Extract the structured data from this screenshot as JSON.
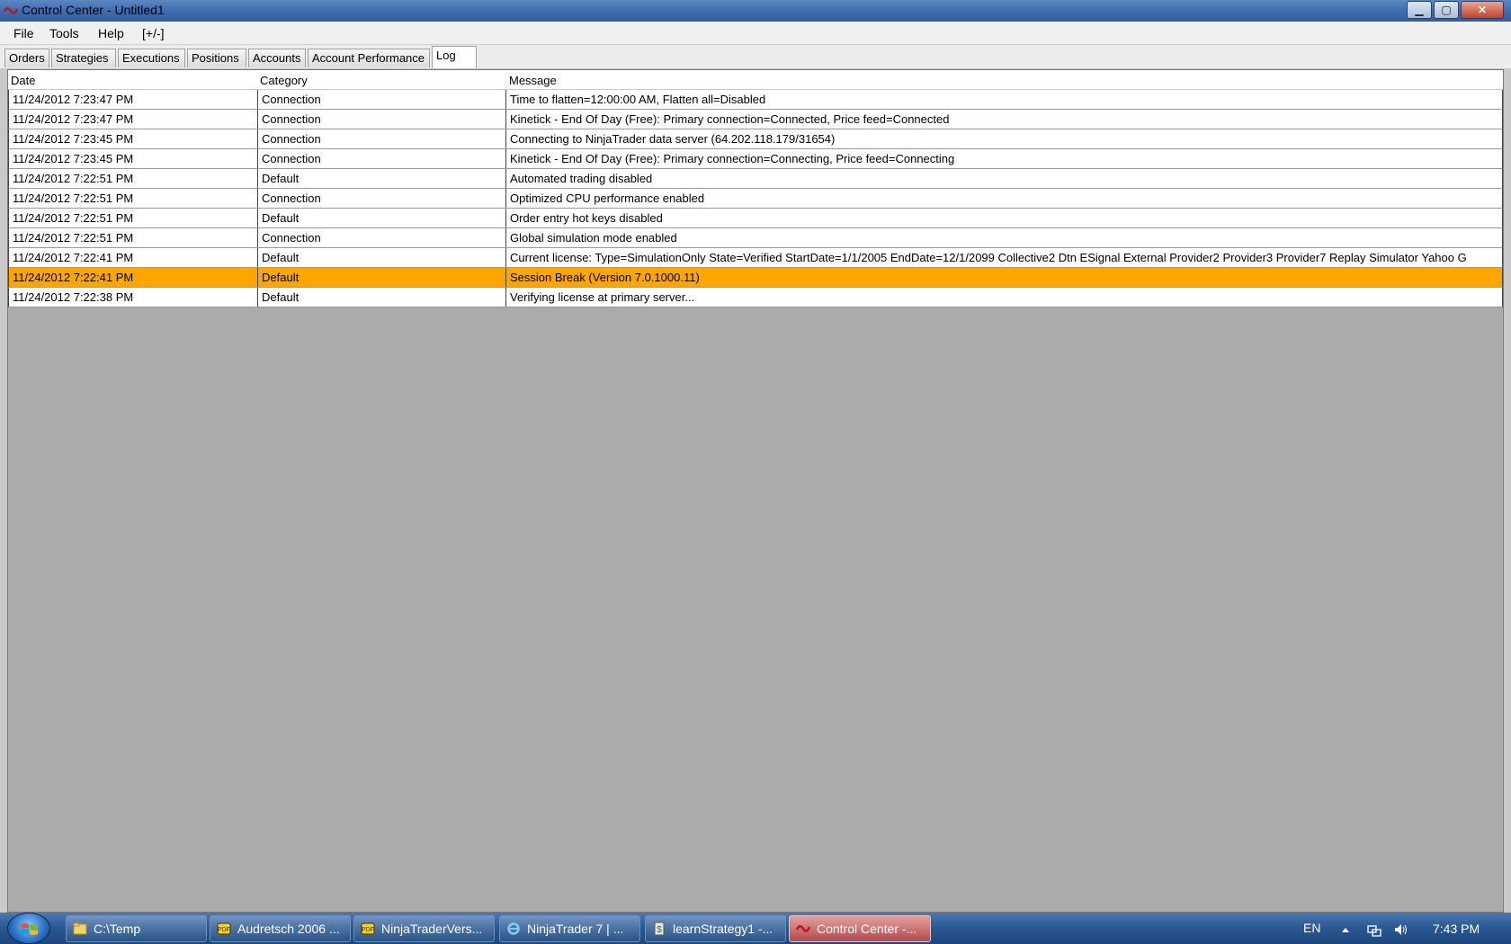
{
  "window": {
    "title": "Control Center - Untitled1",
    "min_glyph": "▁",
    "max_glyph": "▢",
    "close_glyph": "✕"
  },
  "menu": [
    "File",
    "Tools",
    "Help",
    "[+/-]"
  ],
  "tabs": [
    {
      "label": "Orders",
      "active": false
    },
    {
      "label": "Strategies",
      "active": false
    },
    {
      "label": "Executions",
      "active": false
    },
    {
      "label": "Positions",
      "active": false
    },
    {
      "label": "Accounts",
      "active": false
    },
    {
      "label": "Account Performance",
      "active": false
    },
    {
      "label": "Log",
      "active": true
    }
  ],
  "log": {
    "columns": [
      "Date",
      "Category",
      "Message"
    ],
    "rows": [
      {
        "date": "11/24/2012 7:23:47 PM",
        "category": "Connection",
        "message": "Time to flatten=12:00:00 AM, Flatten all=Disabled",
        "highlight": false
      },
      {
        "date": "11/24/2012 7:23:47 PM",
        "category": "Connection",
        "message": "Kinetick - End Of Day (Free): Primary connection=Connected, Price feed=Connected",
        "highlight": false
      },
      {
        "date": "11/24/2012 7:23:45 PM",
        "category": "Connection",
        "message": "Connecting to NinjaTrader data server (64.202.118.179/31654)",
        "highlight": false
      },
      {
        "date": "11/24/2012 7:23:45 PM",
        "category": "Connection",
        "message": "Kinetick - End Of Day (Free): Primary connection=Connecting, Price feed=Connecting",
        "highlight": false
      },
      {
        "date": "11/24/2012 7:22:51 PM",
        "category": "Default",
        "message": "Automated trading disabled",
        "highlight": false
      },
      {
        "date": "11/24/2012 7:22:51 PM",
        "category": "Connection",
        "message": "Optimized CPU performance enabled",
        "highlight": false
      },
      {
        "date": "11/24/2012 7:22:51 PM",
        "category": "Default",
        "message": "Order entry hot keys disabled",
        "highlight": false
      },
      {
        "date": "11/24/2012 7:22:51 PM",
        "category": "Connection",
        "message": "Global simulation mode enabled",
        "highlight": false
      },
      {
        "date": "11/24/2012 7:22:41 PM",
        "category": "Default",
        "message": "Current license: Type=SimulationOnly State=Verified StartDate=1/1/2005 EndDate=12/1/2099 Collective2 Dtn ESignal External Provider2 Provider3 Provider7 Replay Simulator Yahoo G",
        "highlight": false
      },
      {
        "date": "11/24/2012 7:22:41 PM",
        "category": "Default",
        "message": "Session Break (Version 7.0.1000.11)",
        "highlight": true
      },
      {
        "date": "11/24/2012 7:22:38 PM",
        "category": "Default",
        "message": "Verifying license at primary server...",
        "highlight": false
      }
    ],
    "highlight_color": "#ffa500"
  },
  "taskbar": {
    "items": [
      {
        "label": "C:\\Temp",
        "icon": "folder-icon",
        "active": false
      },
      {
        "label": "Audretsch 2006 ...",
        "icon": "pdf-icon",
        "active": false
      },
      {
        "label": "NinjaTraderVers...",
        "icon": "pdf-icon",
        "active": false
      },
      {
        "label": "NinjaTrader 7 | ...",
        "icon": "ie-icon",
        "active": false
      },
      {
        "label": "learnStrategy1 -...",
        "icon": "script-icon",
        "active": false
      },
      {
        "label": "Control Center -...",
        "icon": "ninjatrader-icon",
        "active": true
      }
    ],
    "language": "EN",
    "clock": "7:43 PM"
  }
}
